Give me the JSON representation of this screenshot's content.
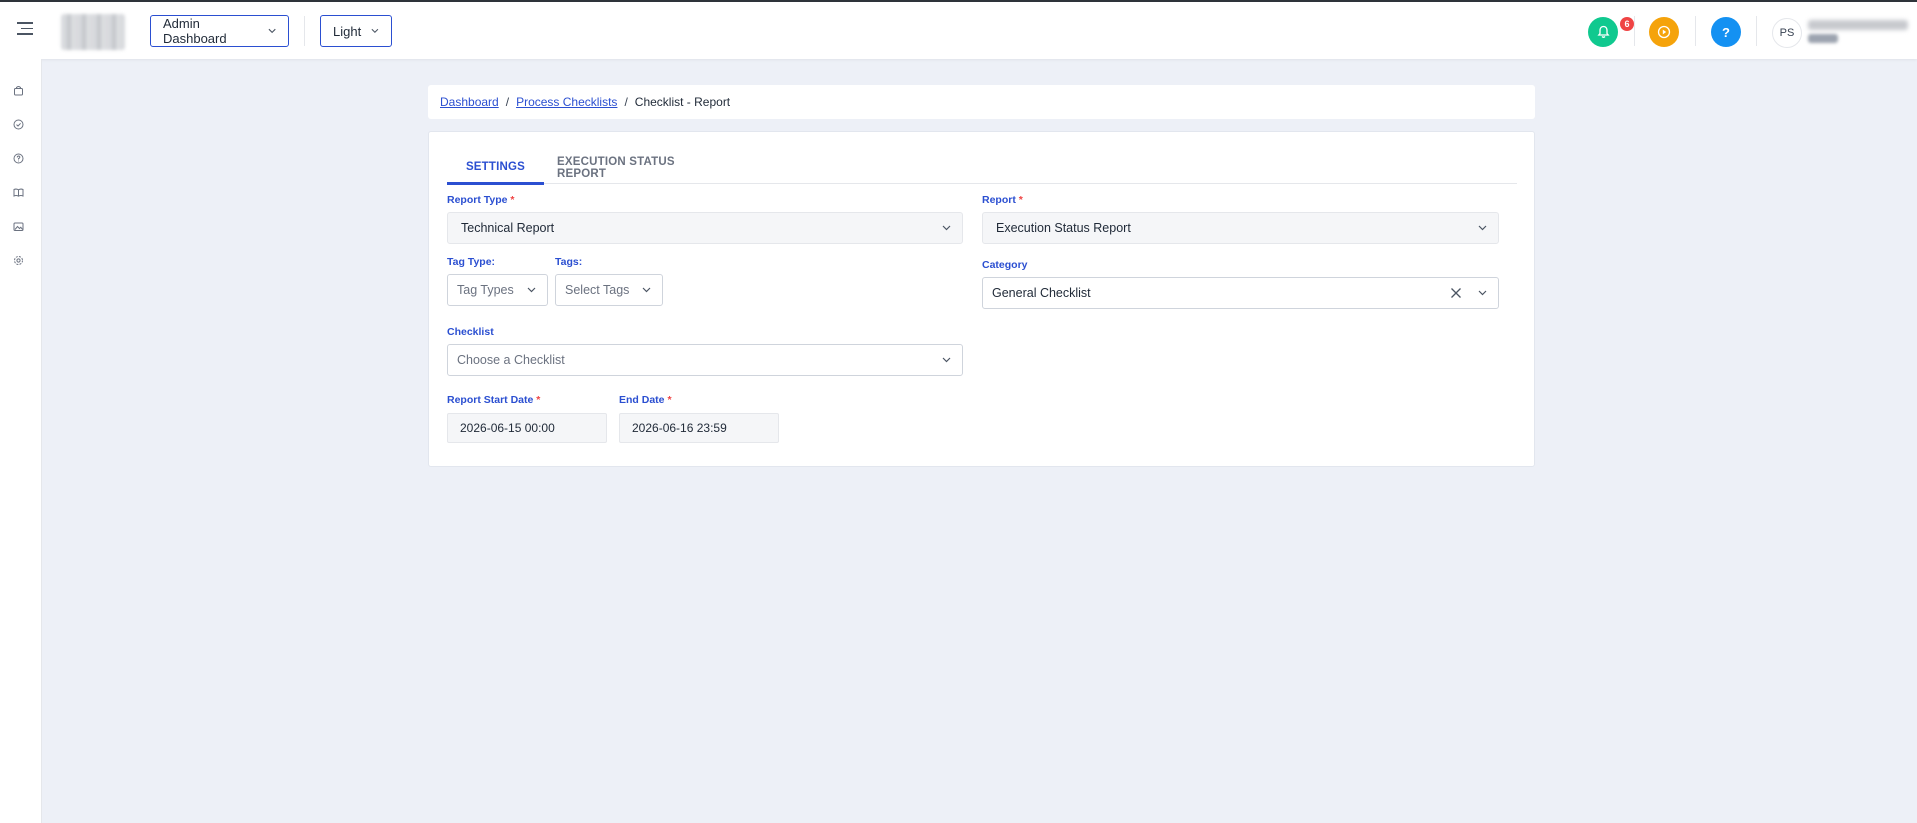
{
  "header": {
    "dashboard_select": "Admin Dashboard",
    "theme_select": "Light",
    "notification_count": "6",
    "help_label": "?",
    "avatar_initials": "PS"
  },
  "colors": {
    "accent": "#2b4fd1",
    "notification": "#10c98f",
    "play": "#f5a30b",
    "help": "#1491f2",
    "badge": "#ef4444"
  },
  "sidebar": {
    "icons": [
      "bag-icon",
      "check-circle-icon",
      "question-circle-icon",
      "book-icon",
      "image-icon",
      "gear-icon"
    ]
  },
  "breadcrumb": {
    "items": [
      "Dashboard",
      "Process Checklists"
    ],
    "separator": "/",
    "current": "Checklist - Report"
  },
  "tabs": [
    "SETTINGS",
    "EXECUTION STATUS REPORT"
  ],
  "form": {
    "report_type_label": "Report Type",
    "report_type_value": "Technical Report",
    "report_label": "Report",
    "report_value": "Execution Status Report",
    "tag_type_label": "Tag Type:",
    "tag_type_placeholder": "Tag Types",
    "tags_label": "Tags:",
    "tags_placeholder": "Select Tags",
    "category_label": "Category",
    "category_value": "General Checklist",
    "checklist_label": "Checklist",
    "checklist_placeholder": "Choose a Checklist",
    "start_date_label": "Report Start Date",
    "start_date_value": "2026-06-15 00:00",
    "end_date_label": "End Date",
    "end_date_value": "2026-06-16 23:59",
    "required_mark": "*"
  }
}
